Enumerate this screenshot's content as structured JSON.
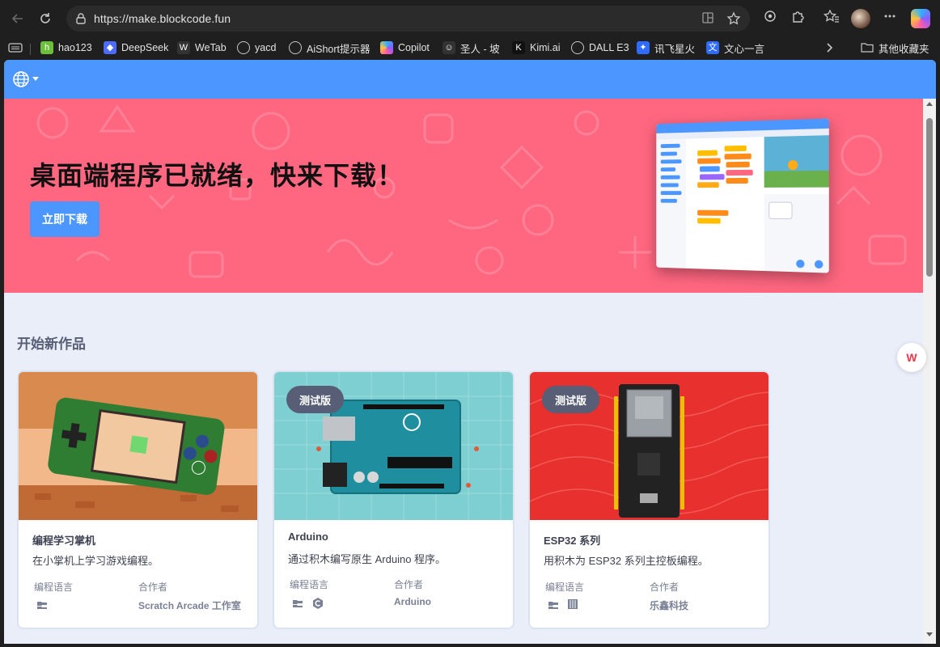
{
  "browser": {
    "url": "https://make.blockcode.fun",
    "icons": [
      "back-icon",
      "reload-icon",
      "lock-icon",
      "split-screen-icon",
      "favorite-star-icon",
      "extension-icon",
      "puzzle-icon",
      "favorites-icon",
      "more-icon",
      "copilot-icon"
    ],
    "bookmarks": [
      {
        "label": "hao123",
        "color": "#6cbf3a"
      },
      {
        "label": "DeepSeek",
        "color": "#4d6bfe"
      },
      {
        "label": "WeTab",
        "color": "#333333"
      },
      {
        "label": "yacd",
        "color": "#5a5a5a"
      },
      {
        "label": "AiShort提示器",
        "color": "#5a5a5a"
      },
      {
        "label": "Copilot",
        "color": "#8a5cff"
      },
      {
        "label": "圣人 - 坡",
        "color": "#333333"
      },
      {
        "label": "Kimi.ai",
        "color": "#111111"
      },
      {
        "label": "DALL E3",
        "color": "#5a5a5a"
      },
      {
        "label": "讯飞星火",
        "color": "#2f6bff"
      },
      {
        "label": "文心一言",
        "color": "#2f6bff"
      }
    ],
    "other_bookmarks": "其他收藏夹"
  },
  "banner": {
    "title": "桌面端程序已就绪，快来下载！",
    "download_label": "立即下载",
    "color": "#ff6680"
  },
  "section": {
    "title": "开始新作品"
  },
  "cards": [
    {
      "title": "编程学习掌机",
      "description": "在小掌机上学习游戏编程。",
      "lang_label": "编程语言",
      "partner_label": "合作者",
      "partner": "Scratch Arcade 工作室",
      "badge": ""
    },
    {
      "title": "Arduino",
      "description": "通过积木编写原生 Arduino 程序。",
      "lang_label": "编程语言",
      "partner_label": "合作者",
      "partner": "Arduino",
      "badge": "测试版"
    },
    {
      "title": "ESP32 系列",
      "description": "用积木为 ESP32 系列主控板编程。",
      "lang_label": "编程语言",
      "partner_label": "合作者",
      "partner": "乐鑫科技",
      "badge": "测试版"
    }
  ],
  "colors": {
    "accent": "#4c97ff",
    "card_bg_2": "#7ecfd1",
    "card_bg_3": "#e8302f"
  }
}
